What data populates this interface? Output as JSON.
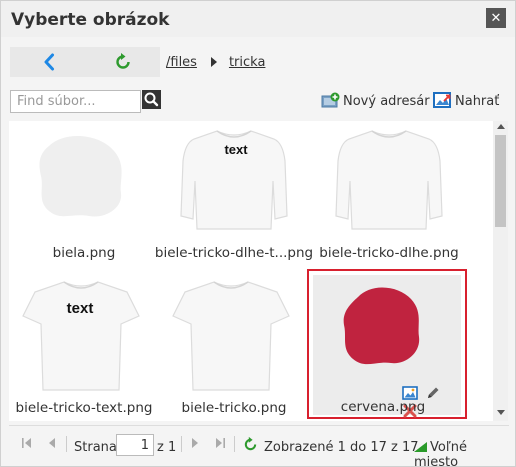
{
  "dialog": {
    "title": "Vyberte obrázok",
    "close_icon": "close-icon"
  },
  "nav": {
    "back_icon": "back-arrow-icon",
    "refresh_icon": "refresh-icon"
  },
  "breadcrumb": {
    "root": "/files",
    "current": "tricka"
  },
  "search": {
    "placeholder": "Find súbor...",
    "value": "",
    "icon": "search-icon"
  },
  "toolbar": {
    "new_dir_label": "Nový adresár",
    "upload_label": "Nahrať"
  },
  "files": [
    {
      "name": "biela.png",
      "thumb": "white-blob"
    },
    {
      "name": "biele-tricko-dlhe-t...png",
      "thumb": "long-sleeve-text"
    },
    {
      "name": "biele-tricko-dlhe.png",
      "thumb": "long-sleeve"
    },
    {
      "name": "biele-tricko-text.png",
      "thumb": "tshirt-text"
    },
    {
      "name": "biele-tricko.png",
      "thumb": "tshirt"
    },
    {
      "name": "cervena.png",
      "thumb": "red-blob",
      "selected": true
    }
  ],
  "thumb_text": "text",
  "colors": {
    "accent_blue": "#1e88e5",
    "accent_green": "#2e9a2e",
    "selection": "#d8202e",
    "red_blob": "#c0233f",
    "delete": "#d9534f"
  },
  "pager": {
    "page_label": "Strana",
    "page_value": "1",
    "of_label": "z 1",
    "status": "Zobrazené 1 do 17 z 17",
    "free_space": "Voľné miesto"
  }
}
